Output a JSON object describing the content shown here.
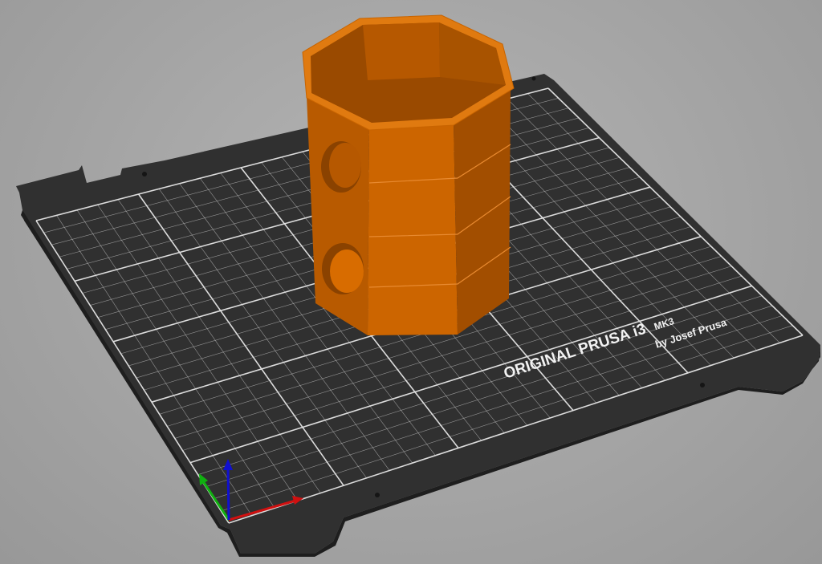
{
  "viewport": {
    "background_color": "#a8a8a8",
    "bed": {
      "plate_color": "#2e2e2e",
      "grid_color": "#e6e6e6",
      "logo": {
        "line1": "ORIGINAL PRUSA i3",
        "line1_suffix": "MK3",
        "line2": "by Josef Prusa"
      }
    },
    "object": {
      "shape": "octagonal-hollow-cylinder",
      "color": "#d16a00",
      "selected": false
    },
    "axes": {
      "x_color": "#d01010",
      "y_color": "#10b010",
      "z_color": "#1010d0"
    }
  }
}
